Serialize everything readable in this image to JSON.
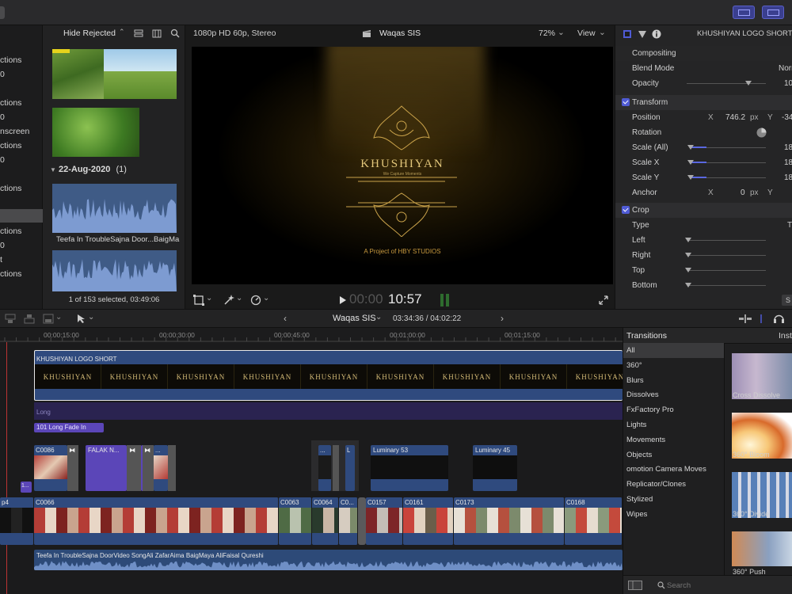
{
  "browser": {
    "filter_label": "Hide Rejected",
    "filter_chevron": "⌃",
    "date_group": "22-Aug-2020",
    "date_group_count": "(1)",
    "audio_clip_label": "Teefa In TroubleSajna Door...BaigMa",
    "status": "1 of 153 selected, 03:49:06"
  },
  "sidebar": {
    "items": [
      "ctions",
      "0",
      "ctions",
      "0",
      "nscreen",
      "ctions",
      "0",
      "ctions",
      "ctions",
      "0",
      "t",
      "ctions"
    ]
  },
  "viewer": {
    "format": "1080p HD 60p, Stereo",
    "project_name": "Waqas SIS",
    "zoom": "72%",
    "view_label": "View",
    "title_text": "KHUSHIYAN",
    "tagline": "We Capture Moments",
    "credit": "A Project of HBY STUDIOS",
    "timecode_dim": "00:00",
    "timecode": "10:57"
  },
  "inspector": {
    "clip_name": "KHUSHIYAN LOGO SHORT",
    "compositing": "Compositing",
    "blend_mode_label": "Blend Mode",
    "blend_mode_value": "Norr",
    "opacity_label": "Opacity",
    "opacity_value": "10",
    "opacity_level": 1.0,
    "transform": "Transform",
    "position_label": "Position",
    "position_x_axis": "X",
    "position_x": "746.2",
    "px_unit": "px",
    "position_y_axis": "Y",
    "position_y": "-34",
    "rotation_label": "Rotation",
    "scale_all_label": "Scale (All)",
    "scale_all_value": "18",
    "scale_x_label": "Scale X",
    "scale_x_value": "18",
    "scale_y_label": "Scale Y",
    "scale_y_value": "18",
    "anchor_label": "Anchor",
    "anchor_x_axis": "X",
    "anchor_x": "0",
    "anchor_y_axis": "Y",
    "crop": "Crop",
    "type_label": "Type",
    "type_value": "T",
    "left_label": "Left",
    "right_label": "Right",
    "top_label": "Top",
    "bottom_label": "Bottom",
    "save_label": "S"
  },
  "timeline": {
    "project_name": "Waqas SIS",
    "duration": "03:34:36 / 04:02:22",
    "ruler_ticks": [
      "00:00:15:00",
      "00:00:30:00",
      "00:00:45:00",
      "00:01:00:00",
      "00:01:15:00"
    ],
    "title_clip": "KHUSHIYAN LOGO SHORT",
    "title_frame_text": "KHUSHIYAN",
    "long_label": "Long",
    "fade_label": "101 Long Fade In",
    "connected": [
      "C0086",
      "FALAK N...",
      "...",
      "...",
      "L",
      "C...",
      "Luminary 53",
      "Luminary 45"
    ],
    "primary": [
      "p4",
      "C0066",
      "C0063",
      "C0064",
      "C0...",
      "C0157",
      "C0161",
      "C0173",
      "C0168"
    ],
    "small_clip": "1...",
    "audio_clip": "Teefa In TroubleSajna DoorVideo SongAli ZafarAima BaigMaya AliFaisal Qureshi"
  },
  "transitions": {
    "header": "Transitions",
    "header_right": "Inst",
    "categories": [
      "All",
      "360°",
      "Blurs",
      "Dissolves",
      "FxFactory Pro",
      "Lights",
      "Movements",
      "Objects",
      "omotion Camera Moves",
      "Replicator/Clones",
      "Stylized",
      "Wipes"
    ],
    "thumbs": [
      "Cross Dissolve",
      "360° Bloom",
      "360° Divide",
      "360° Push"
    ],
    "search_placeholder": "Search"
  },
  "colors": {
    "accent": "#4f5bd5",
    "clip_blue": "#3b5a8a",
    "connected_purple": "#5b46b8",
    "audio_wave": "#6f8fc6"
  }
}
